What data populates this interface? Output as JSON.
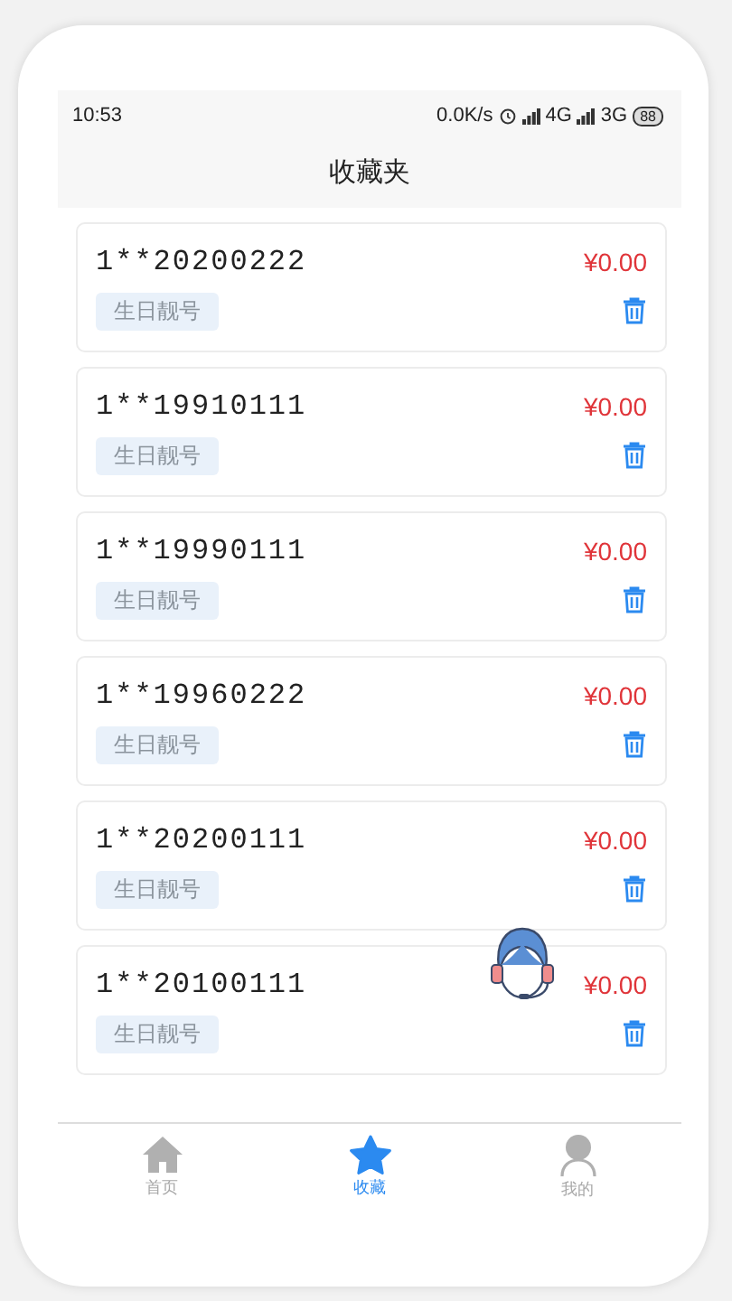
{
  "status_bar": {
    "time": "10:53",
    "speed": "0.0K/s",
    "network_1": "4G",
    "network_2": "3G",
    "battery": "88"
  },
  "title": "收藏夹",
  "favorites": [
    {
      "number": "1**20200222",
      "tag": "生日靓号",
      "price": "¥0.00"
    },
    {
      "number": "1**19910111",
      "tag": "生日靓号",
      "price": "¥0.00"
    },
    {
      "number": "1**19990111",
      "tag": "生日靓号",
      "price": "¥0.00"
    },
    {
      "number": "1**19960222",
      "tag": "生日靓号",
      "price": "¥0.00"
    },
    {
      "number": "1**20200111",
      "tag": "生日靓号",
      "price": "¥0.00"
    },
    {
      "number": "1**20100111",
      "tag": "生日靓号",
      "price": "¥0.00"
    }
  ],
  "tab_bar": [
    {
      "kind": "home",
      "label": "首页",
      "selected": false
    },
    {
      "kind": "star",
      "label": "收藏",
      "selected": true
    },
    {
      "kind": "person",
      "label": "我的",
      "selected": false
    }
  ]
}
